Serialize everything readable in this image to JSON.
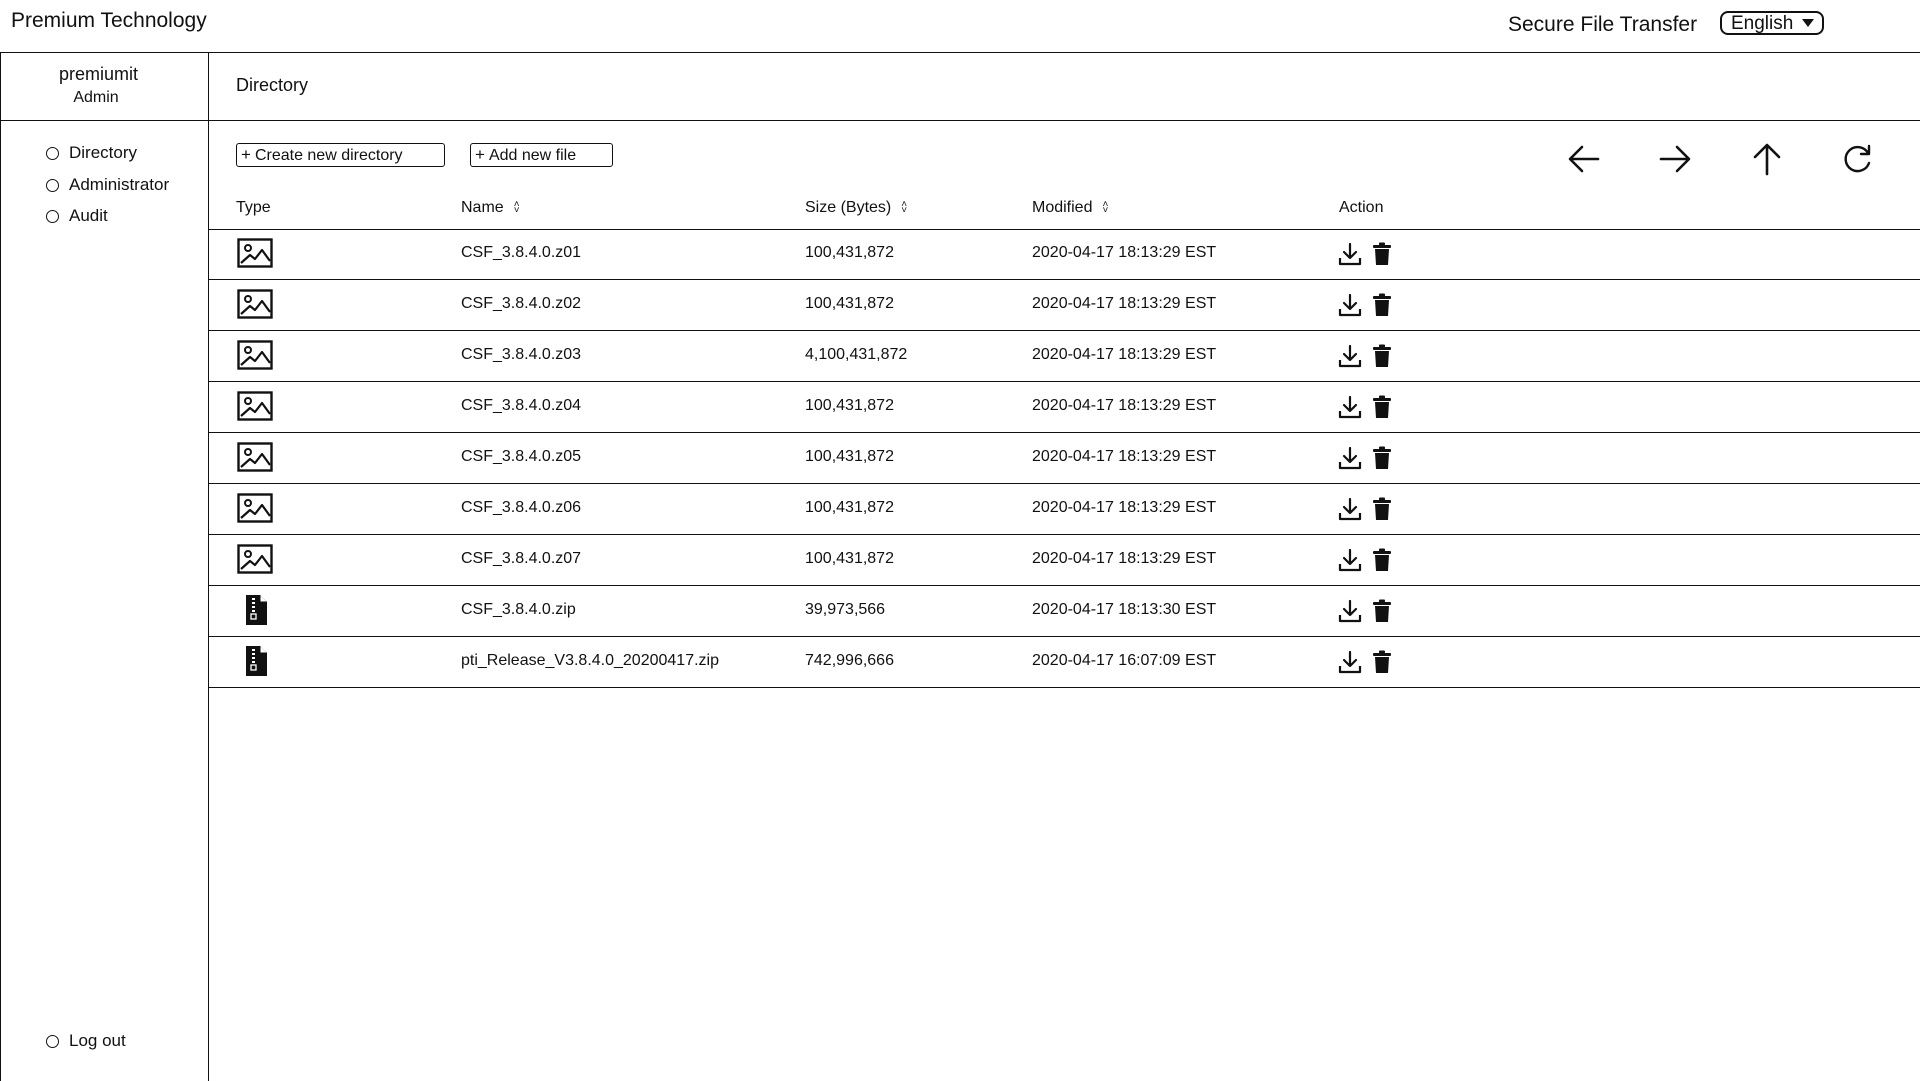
{
  "header": {
    "brand": "Premium Technology",
    "app_title": "Secure File Transfer",
    "language": "English"
  },
  "user": {
    "name": "premiumit",
    "role": "Admin"
  },
  "nav": {
    "items": [
      {
        "label": "Directory"
      },
      {
        "label": "Administrator"
      },
      {
        "label": "Audit"
      }
    ],
    "logout": "Log out"
  },
  "breadcrumb": "Directory",
  "toolbar": {
    "create_dir": "Create new directory",
    "add_file": "Add new file",
    "icons": [
      "back-arrow-icon",
      "forward-arrow-icon",
      "up-arrow-icon",
      "refresh-icon"
    ]
  },
  "table": {
    "headers": {
      "type": "Type",
      "name": "Name",
      "size": "Size (Bytes)",
      "modified": "Modified",
      "action": "Action"
    },
    "rows": [
      {
        "type": "image",
        "name": "CSF_3.8.4.0.z01",
        "size": "100,431,872",
        "modified": "2020-04-17 18:13:29 EST"
      },
      {
        "type": "image",
        "name": "CSF_3.8.4.0.z02",
        "size": "100,431,872",
        "modified": "2020-04-17 18:13:29 EST"
      },
      {
        "type": "image",
        "name": "CSF_3.8.4.0.z03",
        "size": "4,100,431,872",
        "modified": "2020-04-17 18:13:29 EST"
      },
      {
        "type": "image",
        "name": "CSF_3.8.4.0.z04",
        "size": "100,431,872",
        "modified": "2020-04-17 18:13:29 EST"
      },
      {
        "type": "image",
        "name": "CSF_3.8.4.0.z05",
        "size": "100,431,872",
        "modified": "2020-04-17 18:13:29 EST"
      },
      {
        "type": "image",
        "name": "CSF_3.8.4.0.z06",
        "size": "100,431,872",
        "modified": "2020-04-17 18:13:29 EST"
      },
      {
        "type": "image",
        "name": "CSF_3.8.4.0.z07",
        "size": "100,431,872",
        "modified": "2020-04-17 18:13:29 EST"
      },
      {
        "type": "zip",
        "name": "CSF_3.8.4.0.zip",
        "size": "39,973,566",
        "modified": "2020-04-17 18:13:30 EST"
      },
      {
        "type": "zip",
        "name": "pti_Release_V3.8.4.0_20200417.zip",
        "size": "742,996,666",
        "modified": "2020-04-17 16:07:09 EST"
      }
    ]
  }
}
